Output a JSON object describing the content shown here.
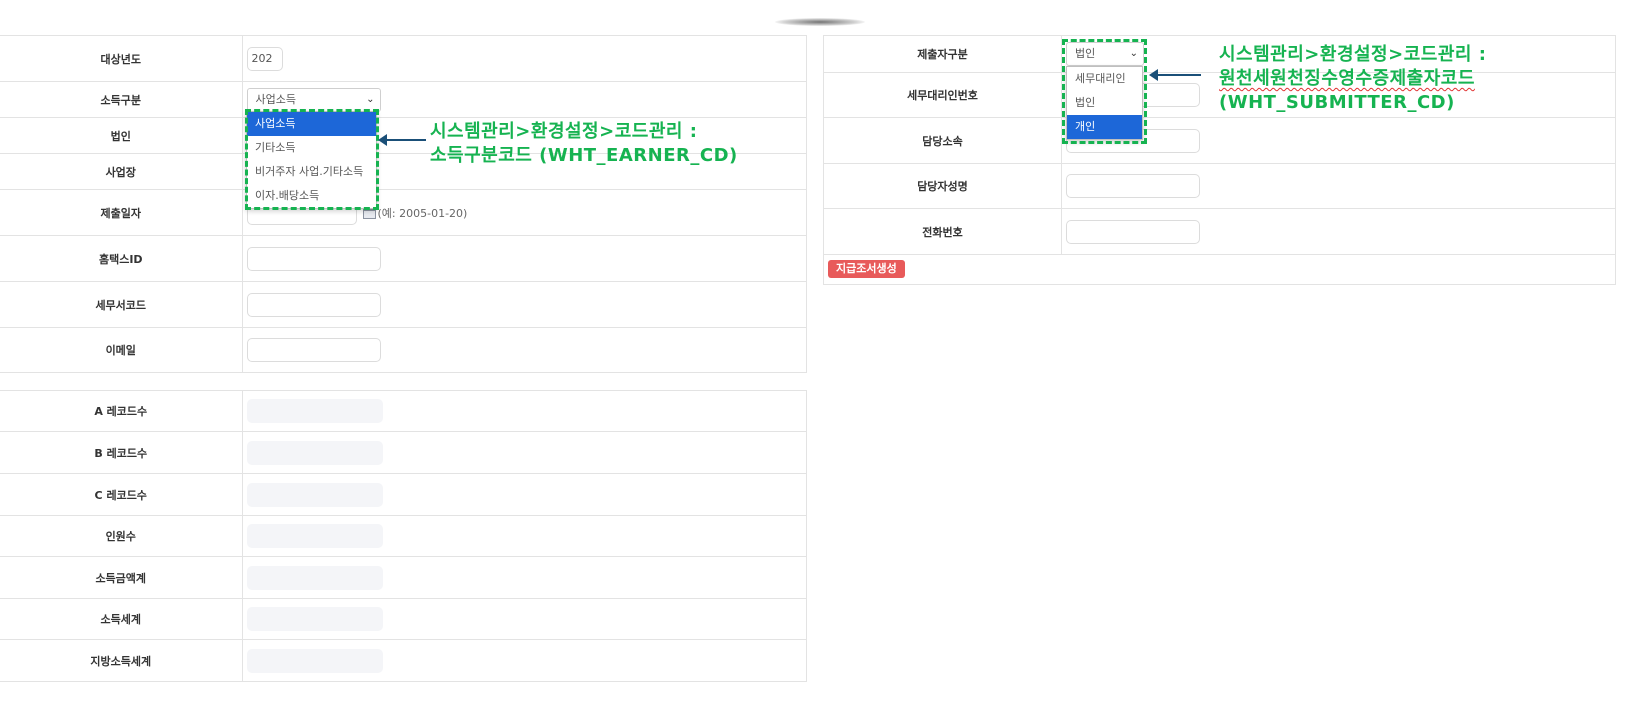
{
  "left_form": {
    "target_year": {
      "label": "대상년도",
      "value": "202"
    },
    "income_type": {
      "label": "소득구분",
      "value": "사업소득"
    },
    "corporation": {
      "label": "법인"
    },
    "business_site": {
      "label": "사업장"
    },
    "submit_date": {
      "label": "제출일자",
      "hint": "(예: 2005-01-20)"
    },
    "hometax_id": {
      "label": "홈택스ID"
    },
    "tax_office_code": {
      "label": "세무서코드"
    },
    "email": {
      "label": "이메일"
    }
  },
  "income_dropdown": {
    "options": [
      "사업소득",
      "기타소득",
      "비거주자 사업.기타소득",
      "이자.배당소득"
    ]
  },
  "summary": {
    "rows": [
      {
        "label": "A 레코드수"
      },
      {
        "label": "B 레코드수"
      },
      {
        "label": "C 레코드수"
      },
      {
        "label": "인원수"
      },
      {
        "label": "소득금액계"
      },
      {
        "label": "소득세계"
      },
      {
        "label": "지방소득세계"
      }
    ]
  },
  "right_form": {
    "submitter_type": {
      "label": "제출자구분",
      "value": "법인"
    },
    "agent_number": {
      "label": "세무대리인번호"
    },
    "department": {
      "label": "담당소속"
    },
    "manager_name": {
      "label": "담당자성명"
    },
    "phone": {
      "label": "전화번호"
    },
    "generate_button": "지급조서생성"
  },
  "submitter_dropdown": {
    "options": [
      "세무대리인",
      "법인",
      "개인"
    ]
  },
  "annotations": {
    "income_line1": "시스템관리>환경설정>코드관리 :",
    "income_line2": "소득구분코드 (WHT_EARNER_CD)",
    "submitter_line1": "시스템관리>환경설정>코드관리 :",
    "submitter_line2": "원천세원천징수영수증제출자코드",
    "submitter_line3": "(WHT_SUBMITTER_CD)"
  },
  "colors": {
    "annotation_green": "#16b351",
    "selected_blue": "#1d67d8",
    "button_red": "#e85a5a",
    "arrow_navy": "#1a4f78"
  }
}
